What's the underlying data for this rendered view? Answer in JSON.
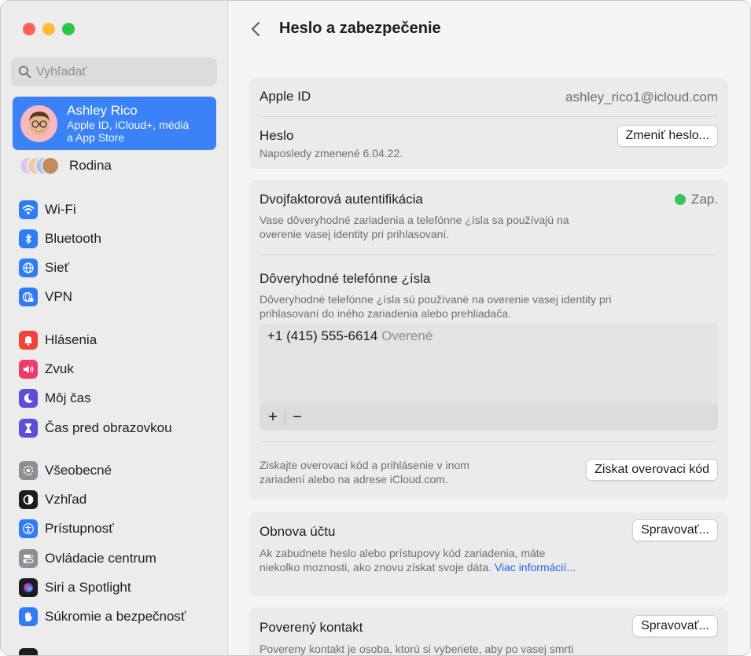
{
  "sidebar": {
    "search_placeholder": "Vyhľadať",
    "account": {
      "name": "Ashley Rico",
      "subtitle_line1": "Apple ID, iCloud+, médiá",
      "subtitle_line2": "a App Store"
    },
    "family_label": "Rodina",
    "items": [
      {
        "label": "Wi-Fi",
        "icon": "wifi-icon",
        "color": "#2f7cf6"
      },
      {
        "label": "Bluetooth",
        "icon": "bluetooth-icon",
        "color": "#2f7cf6"
      },
      {
        "label": "Sieť",
        "icon": "globe-icon",
        "color": "#2f7cf6"
      },
      {
        "label": "VPN",
        "icon": "vpn-globe-icon",
        "color": "#2f7cf6"
      },
      {
        "label": "Hlásenia",
        "icon": "bell-icon",
        "color": "#f0433a"
      },
      {
        "label": "Zvuk",
        "icon": "speaker-icon",
        "color": "#f03a6a"
      },
      {
        "label": "Môj čas",
        "icon": "moon-icon",
        "color": "#5b4fd8"
      },
      {
        "label": "Čas pred obrazovkou",
        "icon": "hourglass-icon",
        "color": "#5b4fd8"
      },
      {
        "label": "Všeobecné",
        "icon": "gear-icon",
        "color": "#8e8e93"
      },
      {
        "label": "Vzhľad",
        "icon": "appearance-icon",
        "color": "#1d1d1f"
      },
      {
        "label": "Prístupnosť",
        "icon": "accessibility-icon",
        "color": "#2f7cf6"
      },
      {
        "label": "Ovládacie centrum",
        "icon": "toggles-icon",
        "color": "#8e8e93"
      },
      {
        "label": "Siri a Spotlight",
        "icon": "siri-icon",
        "color": "#1d1d1f"
      },
      {
        "label": "Súkromie a bezpečnosť",
        "icon": "hand-icon",
        "color": "#2f7cf6"
      }
    ]
  },
  "main": {
    "title": "Heslo a zabezpečenie",
    "apple_id": {
      "label": "Apple ID",
      "value": "ashley_rico1@icloud.com"
    },
    "password": {
      "label": "Heslo",
      "sub": "Naposledy zmenené 6.04.22.",
      "button": "Zmeniť heslo..."
    },
    "two_factor": {
      "label": "Dvojfaktorová autentifikácia",
      "status": "Zap.",
      "status_color": "#34c759",
      "sub_line1": "Vase dôveryhodné zariadenia a telefónne ¿ísla sa používajú na",
      "sub_line2": "overenie vasej identity pri prihlasovaní."
    },
    "trusted_numbers": {
      "label": "Dôveryhodné telefónne ¿ísla",
      "sub_line1": "Dôveryhodné telefónne ¿ísla sú používané na overenie vasej identity pri",
      "sub_line2": "prihlasovaní do iného zariadenia alebo prehliadača.",
      "number": "+1 (415) 555-6614",
      "number_status": "Overené",
      "add_label": "+",
      "remove_label": "−"
    },
    "verification": {
      "sub_line1": "Ziskajte overovaci kód a prihlásenie v inom",
      "sub_line2": "zariadení alebo na adrese iCloud.com.",
      "button": "Ziskat overovaci kód"
    },
    "recovery": {
      "label": "Obnova účtu",
      "button": "Spravovať...",
      "sub_line1": "Ak zabudnete heslo alebo prístupovy kód zariadenia, máte",
      "sub_line2": "niekolko moznosti, ako znovu získat svoje dáta.",
      "link": "Viac informácií..."
    },
    "legacy_contact": {
      "label": "Poverený kontakt",
      "button": "Spravovať...",
      "sub_line1": "Povereny kontakt je osoba, ktorú si vyberiete, aby po vasej smrti"
    }
  }
}
